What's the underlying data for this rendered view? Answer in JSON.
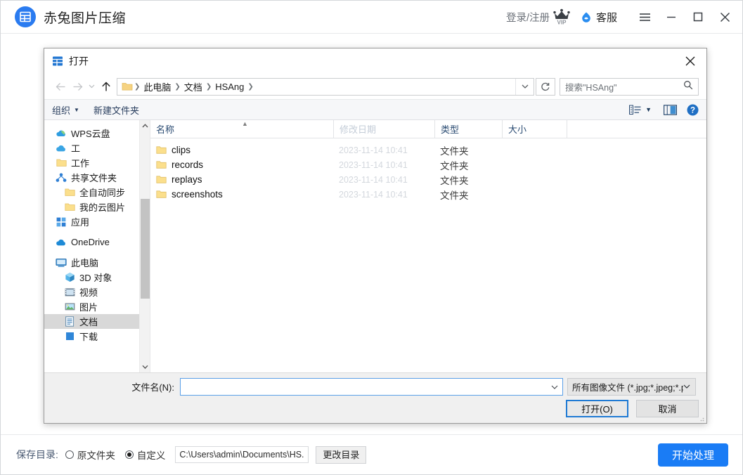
{
  "app": {
    "title": "赤兔图片压缩",
    "titlebar": {
      "login_label": "登录/注册",
      "vip_label": "VIP",
      "support_label": "客服",
      "menu_icon": "hamburger-menu-icon",
      "minimize_icon": "minimize-icon",
      "maximize_icon": "maximize-icon",
      "close_icon": "close-icon"
    },
    "bottom_bar": {
      "save_dir_label": "保存目录:",
      "radio_original": "原文件夹",
      "radio_custom": "自定义",
      "selected_radio": "自定义",
      "path_value": "C:\\Users\\admin\\Documents\\HS.",
      "change_dir_label": "更改目录",
      "start_label": "开始处理",
      "start_color": "#1a7cf5"
    }
  },
  "dialog": {
    "title": "打开",
    "title_icon": "file-explorer-icon",
    "close_icon": "close-icon",
    "nav": {
      "back_icon": "arrow-left-icon",
      "forward_icon": "arrow-right-icon",
      "history_icon": "chevron-down-icon",
      "up_icon": "arrow-up-icon",
      "breadcrumbs": [
        "此电脑",
        "文档",
        "HSAng"
      ],
      "breadcrumb_dropdown_icon": "chevron-down-icon",
      "refresh_icon": "refresh-icon",
      "search_placeholder": "搜索\"HSAng\"",
      "search_icon": "search-icon"
    },
    "command_bar": {
      "organize_label": "组织",
      "organize_caret_icon": "chevron-down-icon",
      "new_folder_label": "新建文件夹",
      "view_icon": "view-options-icon",
      "view_caret_icon": "chevron-down-icon",
      "preview_pane_icon": "preview-pane-icon",
      "help_icon": "help-icon"
    },
    "tree": {
      "groups": [
        {
          "items": [
            {
              "label": "WPS云盘",
              "icon": "wps-cloud-icon",
              "indent": 0,
              "selected": false
            },
            {
              "label": "工",
              "icon": "cloud-icon",
              "indent": 0,
              "selected": false
            },
            {
              "label": "工作",
              "icon": "folder-icon",
              "indent": 0,
              "selected": false
            },
            {
              "label": "共享文件夹",
              "icon": "share-icon",
              "indent": 0,
              "selected": false
            },
            {
              "label": "全自动同步",
              "icon": "folder-icon",
              "indent": 1,
              "selected": false
            },
            {
              "label": "我的云图片",
              "icon": "folder-icon",
              "indent": 1,
              "selected": false
            },
            {
              "label": "应用",
              "icon": "apps-icon",
              "indent": 0,
              "selected": false
            }
          ]
        },
        {
          "items": [
            {
              "label": "OneDrive",
              "icon": "onedrive-icon",
              "indent": 0,
              "selected": false
            }
          ]
        },
        {
          "items": [
            {
              "label": "此电脑",
              "icon": "this-pc-icon",
              "indent": 0,
              "selected": false
            },
            {
              "label": "3D 对象",
              "icon": "3d-objects-icon",
              "indent": 1,
              "selected": false
            },
            {
              "label": "视频",
              "icon": "videos-icon",
              "indent": 1,
              "selected": false
            },
            {
              "label": "图片",
              "icon": "pictures-icon",
              "indent": 1,
              "selected": false
            },
            {
              "label": "文档",
              "icon": "documents-icon",
              "indent": 1,
              "selected": true
            },
            {
              "label": "下载",
              "icon": "downloads-icon",
              "indent": 1,
              "selected": false
            }
          ]
        }
      ],
      "scroll_up_icon": "chevron-up-icon",
      "scroll_down_icon": "chevron-down-icon"
    },
    "list": {
      "columns": [
        "名称",
        "修改日期",
        "类型",
        "大小"
      ],
      "sort_indicator_icon": "sort-ascending-icon",
      "rows": [
        {
          "name": "clips",
          "date": "2023-11-14 10:41",
          "type": "文件夹",
          "size": "",
          "icon": "folder-icon"
        },
        {
          "name": "records",
          "date": "2023-11-14 10:41",
          "type": "文件夹",
          "size": "",
          "icon": "folder-icon"
        },
        {
          "name": "replays",
          "date": "2023-11-14 10:41",
          "type": "文件夹",
          "size": "",
          "icon": "folder-icon"
        },
        {
          "name": "screenshots",
          "date": "2023-11-14 10:41",
          "type": "文件夹",
          "size": "",
          "icon": "folder-icon"
        }
      ]
    },
    "footer": {
      "filename_label": "文件名(N):",
      "filename_value": "",
      "filename_dropdown_icon": "chevron-down-icon",
      "filter_value": "所有图像文件 (*.jpg;*.jpeg;*.p",
      "filter_caret_icon": "chevron-down-icon",
      "open_label": "打开(O)",
      "cancel_label": "取消"
    }
  }
}
